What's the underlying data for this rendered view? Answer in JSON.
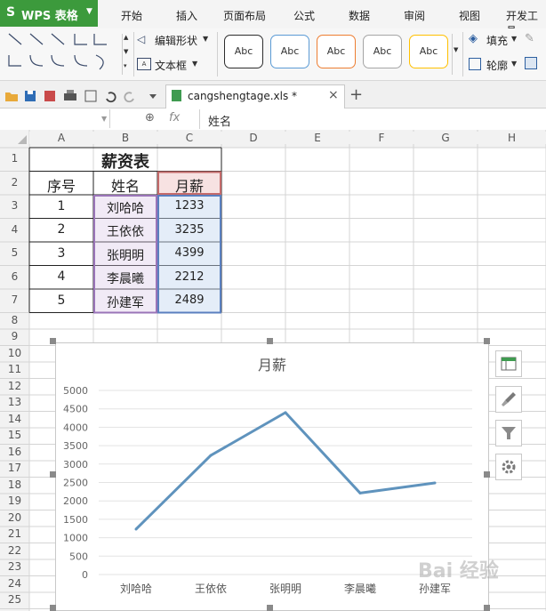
{
  "app": {
    "title": "WPS 表格",
    "logo": "S"
  },
  "menu": [
    "开始",
    "插入",
    "页面布局",
    "公式",
    "数据",
    "审阅",
    "视图",
    "开发工具"
  ],
  "ribbon": {
    "edit_shape": "编辑形状",
    "text_box": "文本框",
    "fill": "填充",
    "outline": "轮廓",
    "style_label": "Abc",
    "style_colors": [
      "#2d2d2d",
      "#5b9bd5",
      "#ed7d31",
      "#a5a5a5",
      "#ffc000"
    ]
  },
  "file_tab": {
    "name": "cangshengtage.xls *",
    "close": "×",
    "add": "+"
  },
  "formula_bar": {
    "fx": "fx",
    "content": "姓名"
  },
  "sheet": {
    "columns": [
      "A",
      "B",
      "C",
      "D",
      "E",
      "F",
      "G",
      "H"
    ],
    "rows": [
      "1",
      "2",
      "3",
      "4",
      "5",
      "6",
      "7",
      "8",
      "9",
      "10",
      "11",
      "12",
      "13",
      "14",
      "15",
      "16",
      "17",
      "18",
      "19",
      "20",
      "21",
      "22",
      "23",
      "24",
      "25"
    ],
    "table_title": "薪资表",
    "headers": [
      "序号",
      "姓名",
      "月薪"
    ],
    "data": [
      [
        "1",
        "刘哈哈",
        "1233"
      ],
      [
        "2",
        "王依依",
        "3235"
      ],
      [
        "3",
        "张明明",
        "4399"
      ],
      [
        "4",
        "李晨曦",
        "2212"
      ],
      [
        "5",
        "孙建军",
        "2489"
      ]
    ]
  },
  "chart_data": {
    "type": "line",
    "title": "月薪",
    "categories": [
      "刘哈哈",
      "王依依",
      "张明明",
      "李晨曦",
      "孙建军"
    ],
    "series": [
      {
        "name": "月薪",
        "values": [
          1233,
          3235,
          4399,
          2212,
          2489
        ],
        "color": "#5f93bd"
      }
    ],
    "ylim": [
      0,
      5000
    ],
    "yticks": [
      "0",
      "500",
      "1000",
      "1500",
      "2000",
      "2500",
      "3000",
      "3500",
      "4000",
      "4500",
      "5000"
    ],
    "grid": true
  },
  "watermark": "Bai 经验"
}
